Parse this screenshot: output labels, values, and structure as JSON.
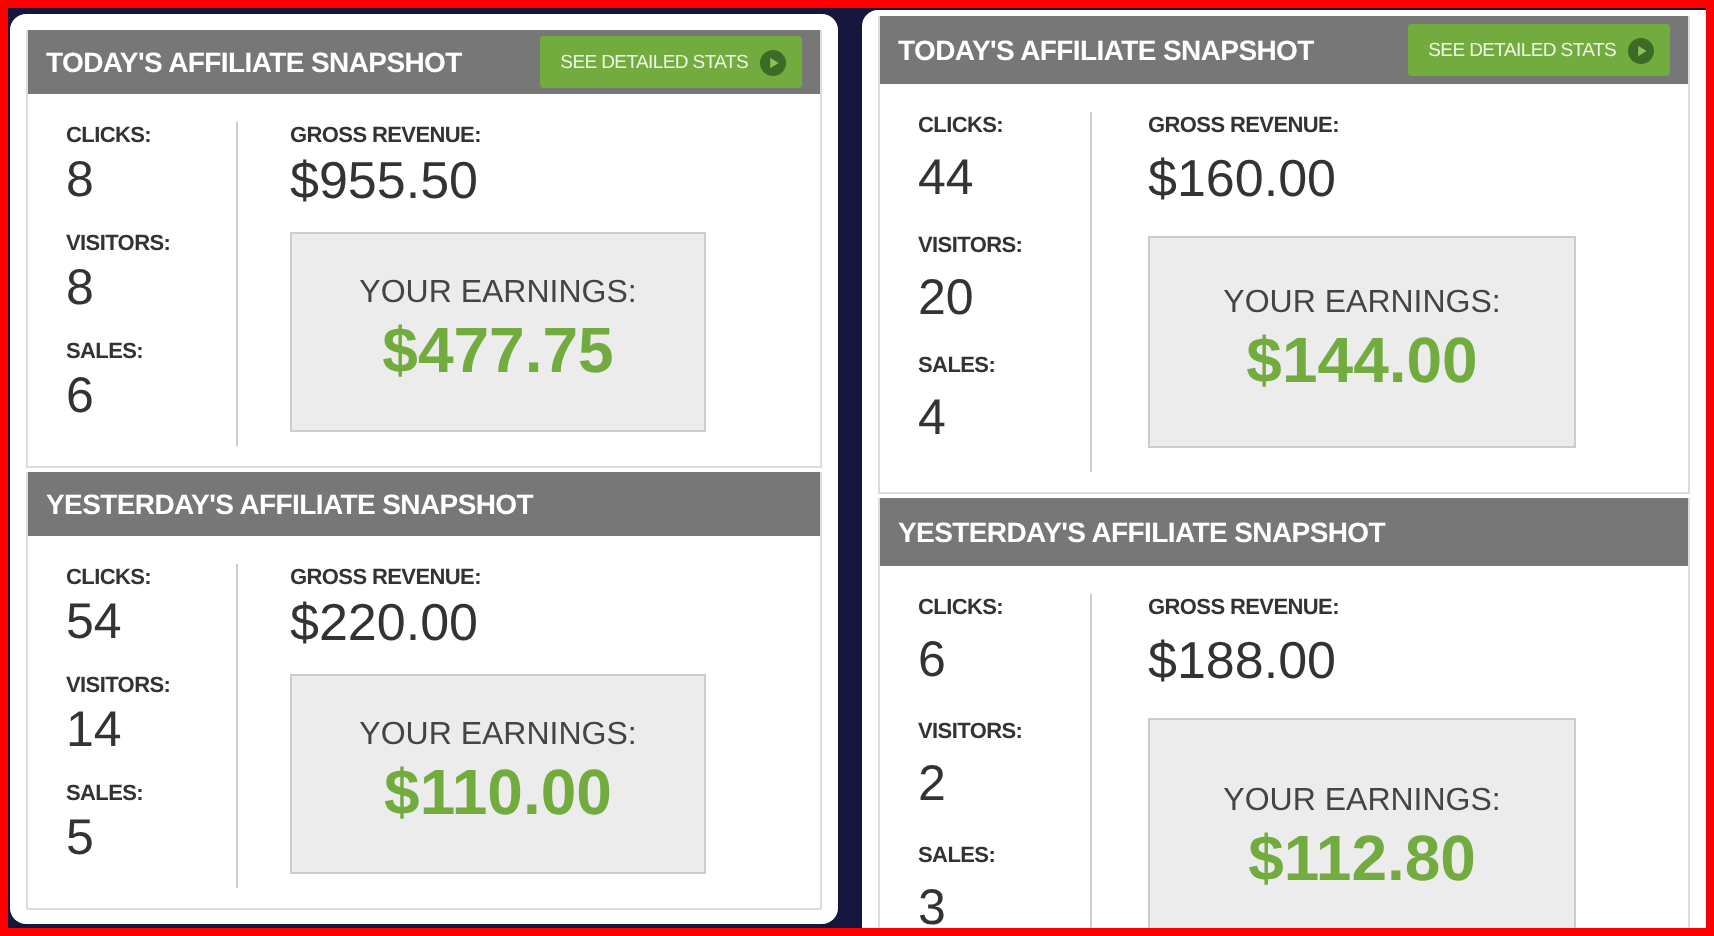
{
  "panels": [
    {
      "sections": [
        {
          "title": "TODAY'S AFFILIATE SNAPSHOT",
          "button": "SEE DETAILED STATS",
          "stats": [
            {
              "label": "CLICKS:",
              "value": "8"
            },
            {
              "label": "VISITORS:",
              "value": "8"
            },
            {
              "label": "SALES:",
              "value": "6"
            }
          ],
          "revenue_label": "GROSS REVENUE:",
          "revenue": "$955.50",
          "earnings_label": "YOUR EARNINGS:",
          "earnings": "$477.75"
        },
        {
          "title": "YESTERDAY'S AFFILIATE SNAPSHOT",
          "stats": [
            {
              "label": "CLICKS:",
              "value": "54"
            },
            {
              "label": "VISITORS:",
              "value": "14"
            },
            {
              "label": "SALES:",
              "value": "5"
            }
          ],
          "revenue_label": "GROSS REVENUE:",
          "revenue": "$220.00",
          "earnings_label": "YOUR EARNINGS:",
          "earnings": "$110.00"
        }
      ]
    },
    {
      "sections": [
        {
          "title": "TODAY'S AFFILIATE SNAPSHOT",
          "button": "SEE DETAILED STATS",
          "stats": [
            {
              "label": "CLICKS:",
              "value": "44"
            },
            {
              "label": "VISITORS:",
              "value": "20"
            },
            {
              "label": "SALES:",
              "value": "4"
            }
          ],
          "revenue_label": "GROSS REVENUE:",
          "revenue": "$160.00",
          "earnings_label": "YOUR EARNINGS:",
          "earnings": "$144.00"
        },
        {
          "title": "YESTERDAY'S AFFILIATE SNAPSHOT",
          "stats": [
            {
              "label": "CLICKS:",
              "value": "6"
            },
            {
              "label": "VISITORS:",
              "value": "2"
            },
            {
              "label": "SALES:",
              "value": "3"
            }
          ],
          "revenue_label": "GROSS REVENUE:",
          "revenue": "$188.00",
          "earnings_label": "YOUR EARNINGS:",
          "earnings": "$112.80"
        }
      ]
    }
  ]
}
